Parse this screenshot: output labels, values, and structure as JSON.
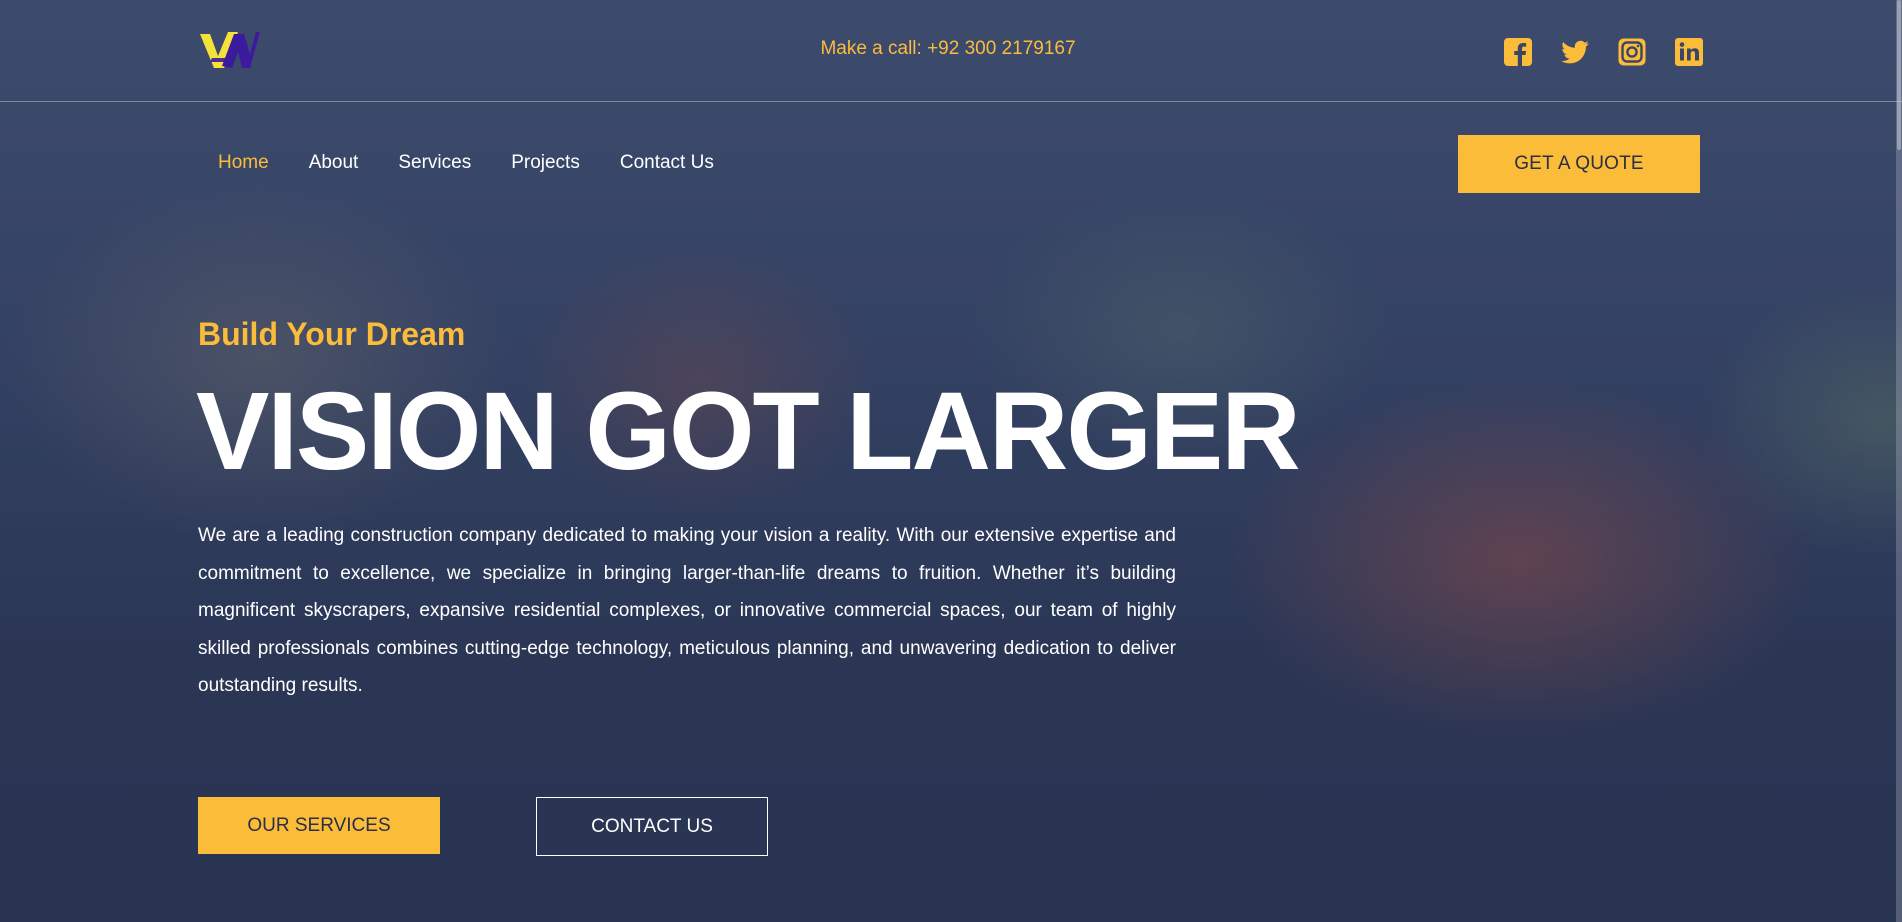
{
  "header": {
    "call_text": "Make a call: +92 300 2179167",
    "social_icons": [
      "facebook-icon",
      "twitter-icon",
      "instagram-icon",
      "linkedin-icon"
    ]
  },
  "nav": {
    "items": [
      {
        "label": "Home",
        "active": true
      },
      {
        "label": "About",
        "active": false
      },
      {
        "label": "Services",
        "active": false
      },
      {
        "label": "Projects",
        "active": false
      },
      {
        "label": "Contact Us",
        "active": false
      }
    ],
    "quote_label": "GET A QUOTE"
  },
  "hero": {
    "tagline": "Build Your Dream",
    "headline": "VISION GOT LARGER",
    "description": "We are a leading construction company dedicated to making your vision a reality. With our extensive expertise and commitment to excellence, we specialize in bringing larger-than-life dreams to fruition. Whether it’s building magnificent skyscrapers, expansive residential complexes, or innovative commercial spaces, our team of highly skilled professionals combines cutting-edge technology, meticulous planning, and unwavering dedication to deliver outstanding results.",
    "primary_button": "OUR SERVICES",
    "secondary_button": "CONTACT US"
  },
  "colors": {
    "accent": "#fbbc3a",
    "overlay": "#2c3552",
    "logo_yellow": "#f4e23a",
    "logo_purple": "#3b1a9e"
  }
}
